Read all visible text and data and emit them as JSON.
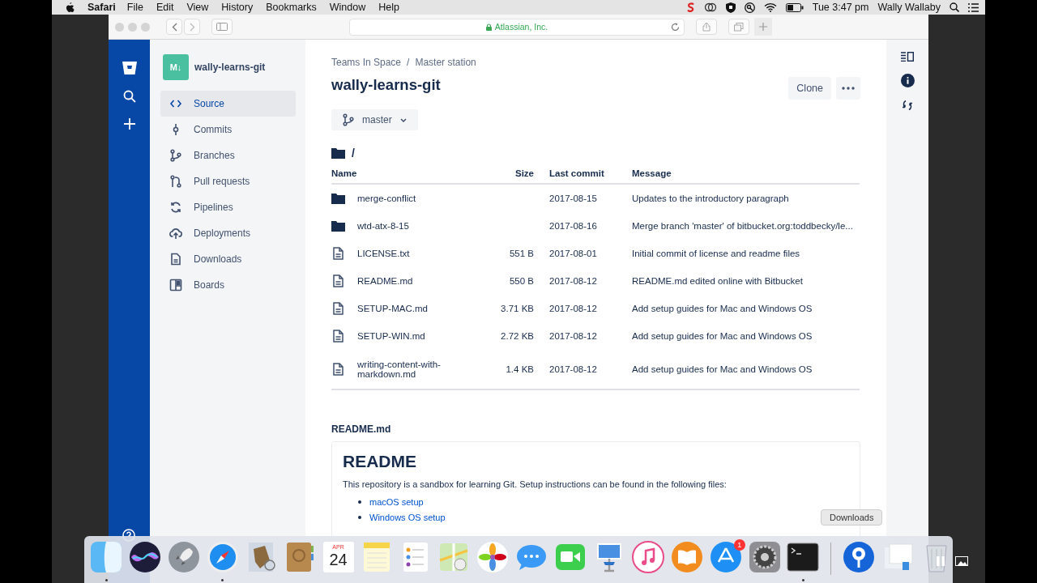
{
  "menubar": {
    "app": "Safari",
    "menus": [
      "File",
      "Edit",
      "View",
      "History",
      "Bookmarks",
      "Window",
      "Help"
    ],
    "clock": "Tue 3:47 pm",
    "user": "Wally Wallaby"
  },
  "browser": {
    "address": "Atlassian, Inc."
  },
  "sidebar": {
    "repo": "wally-learns-git",
    "logo_text": "M↓",
    "items": [
      {
        "label": "Source",
        "selected": true
      },
      {
        "label": "Commits",
        "selected": false
      },
      {
        "label": "Branches",
        "selected": false
      },
      {
        "label": "Pull requests",
        "selected": false
      },
      {
        "label": "Pipelines",
        "selected": false
      },
      {
        "label": "Deployments",
        "selected": false
      },
      {
        "label": "Downloads",
        "selected": false
      },
      {
        "label": "Boards",
        "selected": false
      }
    ]
  },
  "breadcrumbs": [
    "Teams In Space",
    "Master station"
  ],
  "breadcrumb_separator": "/",
  "title": "wally-learns-git",
  "clone_button": "Clone",
  "branch": "master",
  "path": "/",
  "table": {
    "columns": [
      "Name",
      "Size",
      "Last commit",
      "Message"
    ],
    "rows": [
      {
        "kind": "folder",
        "name": "merge-conflict",
        "size": "",
        "date": "2017-08-15",
        "message": "Updates to the introductory paragraph"
      },
      {
        "kind": "folder",
        "name": "wtd-atx-8-15",
        "size": "",
        "date": "2017-08-16",
        "message": "Merge branch 'master' of bitbucket.org:toddbecky/le..."
      },
      {
        "kind": "file",
        "name": "LICENSE.txt",
        "size": "551 B",
        "date": "2017-08-01",
        "message": "Initial commit of license and readme files"
      },
      {
        "kind": "file",
        "name": "README.md",
        "size": "550 B",
        "date": "2017-08-12",
        "message": "README.md edited online with Bitbucket"
      },
      {
        "kind": "file",
        "name": "SETUP-MAC.md",
        "size": "3.71 KB",
        "date": "2017-08-12",
        "message": "Add setup guides for Mac and Windows OS"
      },
      {
        "kind": "file",
        "name": "SETUP-WIN.md",
        "size": "2.72 KB",
        "date": "2017-08-12",
        "message": "Add setup guides for Mac and Windows OS"
      },
      {
        "kind": "file",
        "name": "writing-content-with-markdown.md",
        "size": "1.4 KB",
        "date": "2017-08-12",
        "message": "Add setup guides for Mac and Windows OS"
      }
    ]
  },
  "readme": {
    "file": "README.md",
    "heading": "README",
    "text": "This repository is a sandbox for learning Git. Setup instructions can be found in the following files:",
    "links": [
      "macOS setup",
      "Windows OS setup"
    ]
  },
  "dock": {
    "tooltip": "Downloads",
    "items": [
      {
        "kind": "finder",
        "running": true
      },
      {
        "kind": "siri",
        "running": false
      },
      {
        "kind": "launchpad",
        "running": false
      },
      {
        "kind": "safari",
        "running": true
      },
      {
        "kind": "mail",
        "running": false
      },
      {
        "kind": "contacts",
        "running": false
      },
      {
        "kind": "calendar",
        "running": false,
        "month": "APR",
        "day": "24"
      },
      {
        "kind": "notes",
        "running": false
      },
      {
        "kind": "reminders",
        "running": false
      },
      {
        "kind": "maps",
        "running": false
      },
      {
        "kind": "photos",
        "running": false
      },
      {
        "kind": "messages",
        "running": false
      },
      {
        "kind": "facetime",
        "running": false
      },
      {
        "kind": "keynote",
        "running": false
      },
      {
        "kind": "itunes",
        "running": false
      },
      {
        "kind": "ibooks",
        "running": false
      },
      {
        "kind": "appstore",
        "running": false,
        "badge": "1"
      },
      {
        "kind": "preferences",
        "running": false
      },
      {
        "kind": "terminal",
        "running": true
      },
      {
        "kind": "separator"
      },
      {
        "kind": "downloads",
        "running": false
      },
      {
        "kind": "stack",
        "running": false
      },
      {
        "kind": "trash",
        "running": false
      }
    ]
  }
}
